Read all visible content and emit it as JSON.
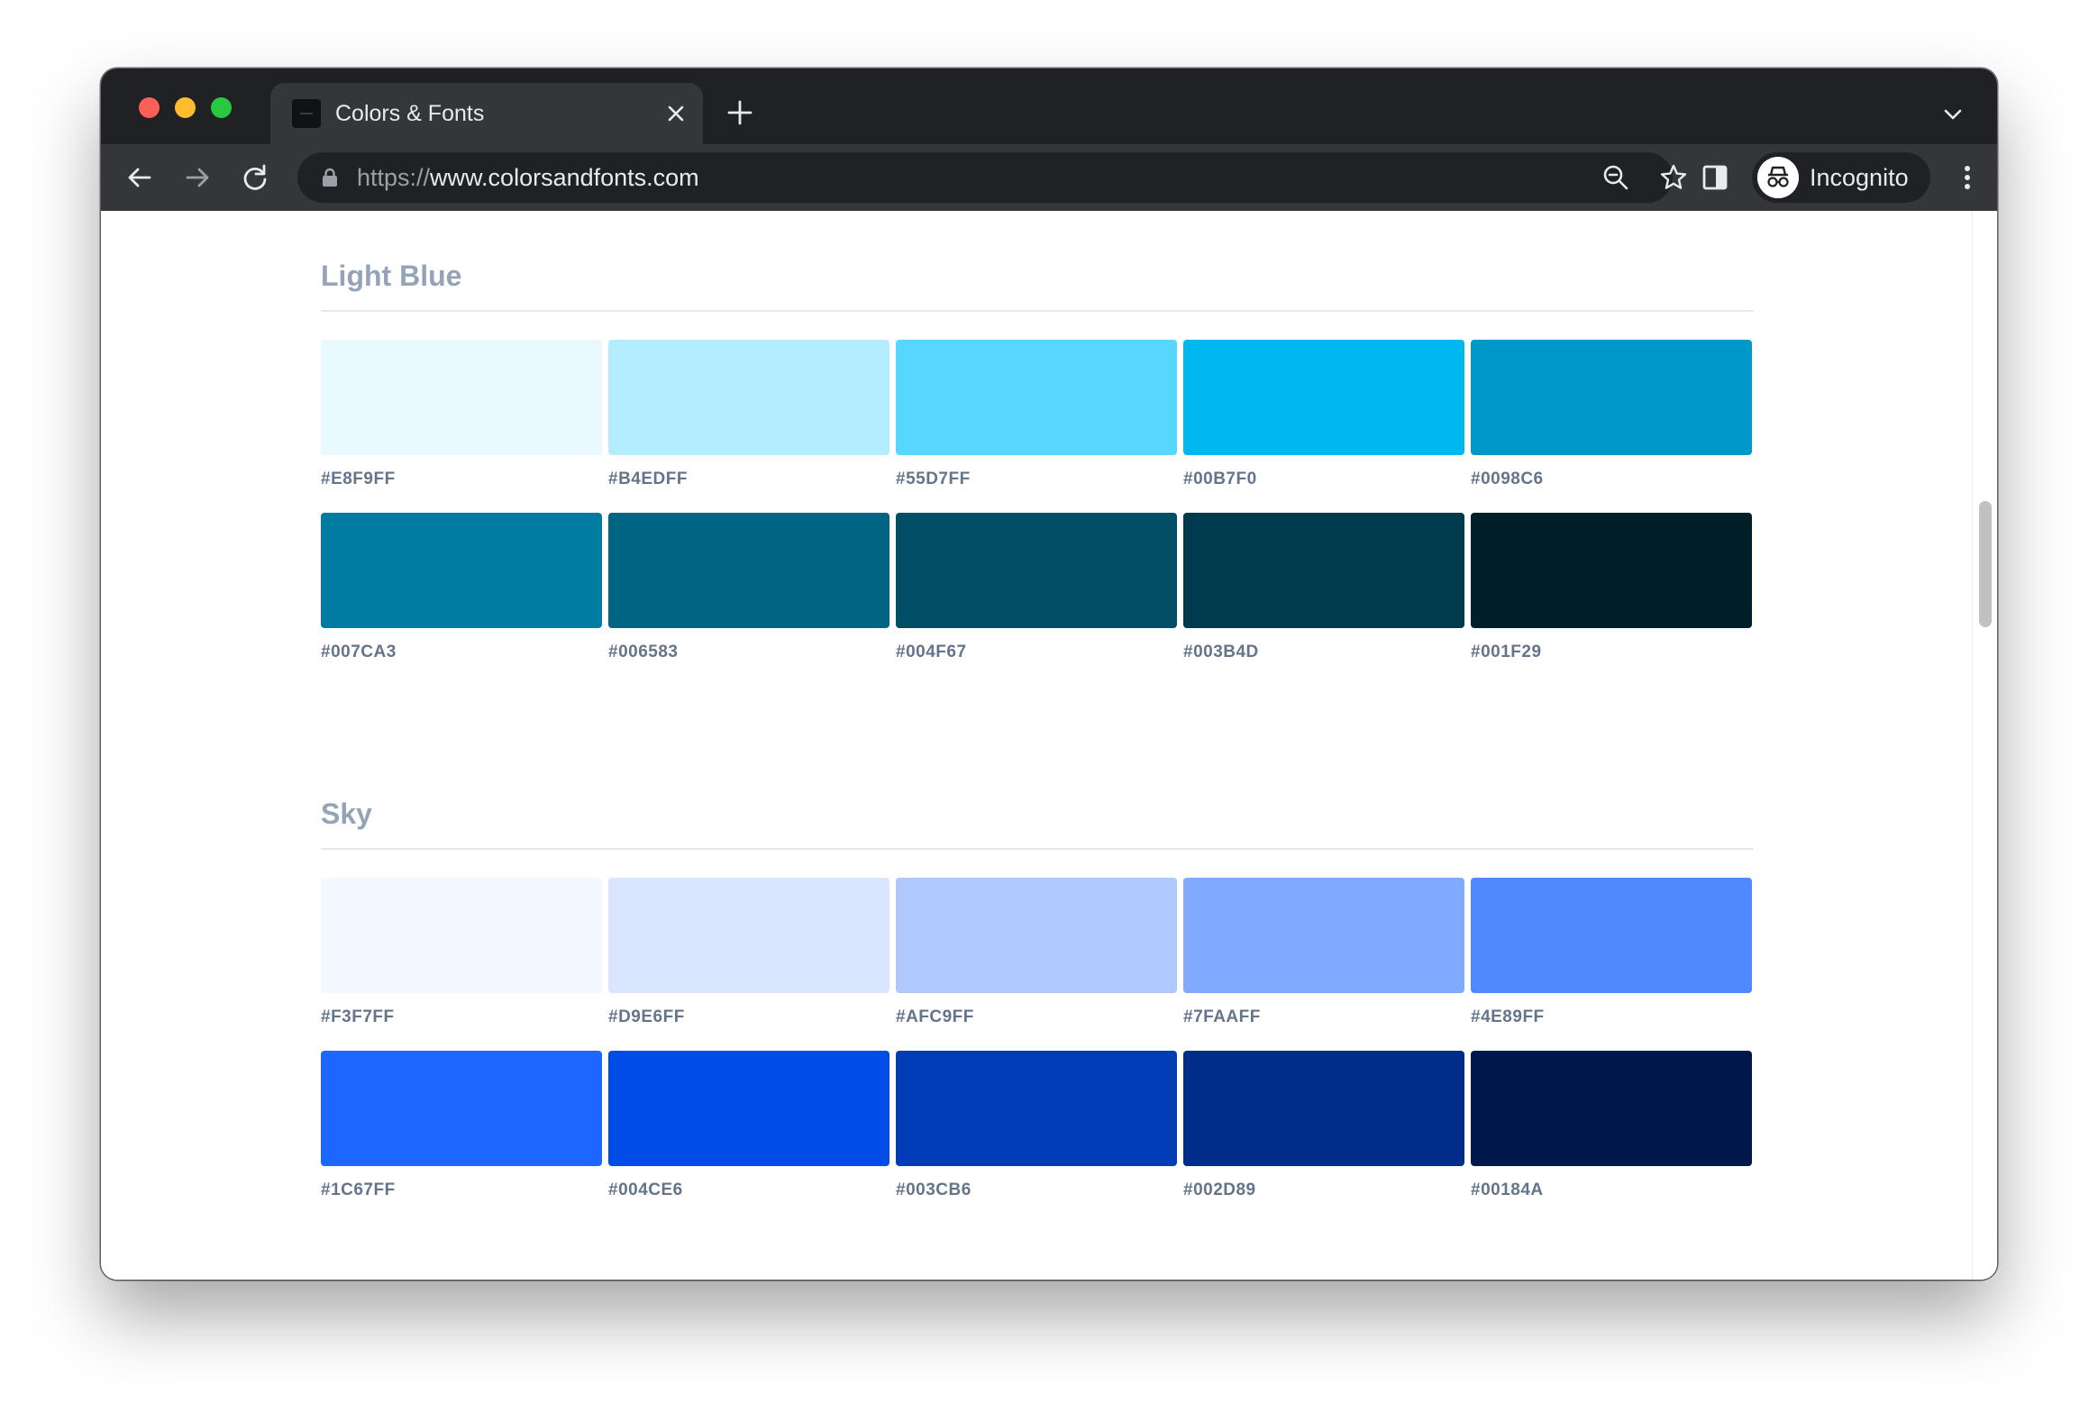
{
  "browser": {
    "tab_title": "Colors & Fonts",
    "url_scheme": "https://",
    "url_host": "www.colorsandfonts.com",
    "profile_label": "Incognito"
  },
  "sections": [
    {
      "title": "Light Blue",
      "swatches": [
        {
          "hex": "#E8F9FF"
        },
        {
          "hex": "#B4EDFF"
        },
        {
          "hex": "#55D7FF"
        },
        {
          "hex": "#00B7F0"
        },
        {
          "hex": "#0098C6"
        },
        {
          "hex": "#007CA3"
        },
        {
          "hex": "#006583"
        },
        {
          "hex": "#004F67"
        },
        {
          "hex": "#003B4D"
        },
        {
          "hex": "#001F29"
        }
      ]
    },
    {
      "title": "Sky",
      "swatches": [
        {
          "hex": "#F3F7FF"
        },
        {
          "hex": "#D9E6FF"
        },
        {
          "hex": "#AFC9FF"
        },
        {
          "hex": "#7FAAFF"
        },
        {
          "hex": "#4E89FF"
        },
        {
          "hex": "#1C67FF"
        },
        {
          "hex": "#004CE6"
        },
        {
          "hex": "#003CB6"
        },
        {
          "hex": "#002D89"
        },
        {
          "hex": "#00184A"
        }
      ]
    }
  ]
}
